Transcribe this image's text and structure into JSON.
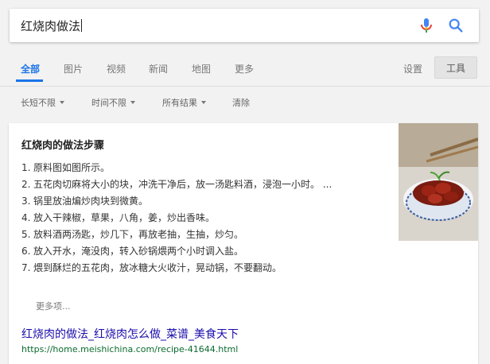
{
  "search": {
    "query": "红烧肉做法"
  },
  "tabs": [
    {
      "label": "全部"
    },
    {
      "label": "图片"
    },
    {
      "label": "视频"
    },
    {
      "label": "新闻"
    },
    {
      "label": "地图"
    },
    {
      "label": "更多"
    }
  ],
  "settings_label": "设置",
  "tools_label": "工具",
  "filters": [
    {
      "label": "长短不限"
    },
    {
      "label": "时间不限"
    },
    {
      "label": "所有结果"
    },
    {
      "label": "清除"
    }
  ],
  "result": {
    "title": "红烧肉的做法步骤",
    "steps": [
      {
        "num": "1.",
        "text": "原料图如图所示。"
      },
      {
        "num": "2.",
        "text": "五花肉切麻将大小的块，冲洗干净后，放一汤匙料酒，浸泡一小时。 ..."
      },
      {
        "num": "3.",
        "text": "锅里放油煸炒肉块到微黄。"
      },
      {
        "num": "4.",
        "text": "放入干辣椒，草果，八角，姜，炒出香味。"
      },
      {
        "num": "5.",
        "text": "放料酒两汤匙，炒几下，再放老抽，生抽，炒匀。"
      },
      {
        "num": "6.",
        "text": "放入开水，淹没肉，转入砂锅煨两个小时调入盐。"
      },
      {
        "num": "7.",
        "text": "煨到酥烂的五花肉，放冰糖大火收汁，晃动锅，不要翻动。"
      }
    ],
    "more_label": "更多项...",
    "link_text": "红烧肉的做法_红烧肉怎么做_菜谱_美食天下",
    "url": "https://home.meishichina.com/recipe-41644.html"
  },
  "colors": {
    "accent": "#1a73e8",
    "link": "#1a0dab",
    "url": "#0b6b2f"
  }
}
